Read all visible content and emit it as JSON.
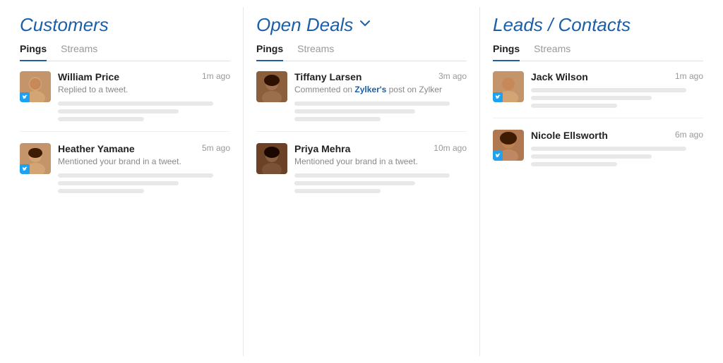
{
  "columns": [
    {
      "title": "Customers",
      "hasDropdown": false,
      "tabs": [
        {
          "label": "Pings",
          "active": true
        },
        {
          "label": "Streams",
          "active": false
        }
      ],
      "items": [
        {
          "id": "william",
          "name": "William Price",
          "time": "1m ago",
          "description": "Replied to a tweet.",
          "avatarClass": "face-william",
          "hasBadge": true,
          "skeletons": [
            {
              "width": "w-full"
            },
            {
              "width": "w-3q"
            },
            {
              "width": "w-half"
            }
          ]
        },
        {
          "id": "heather",
          "name": "Heather Yamane",
          "time": "5m ago",
          "description": "Mentioned your brand in a tweet.",
          "avatarClass": "face-heather",
          "hasBadge": true,
          "skeletons": [
            {
              "width": "w-full"
            },
            {
              "width": "w-3q"
            },
            {
              "width": "w-half"
            }
          ]
        }
      ]
    },
    {
      "title": "Open Deals",
      "hasDropdown": true,
      "tabs": [
        {
          "label": "Pings",
          "active": true
        },
        {
          "label": "Streams",
          "active": false
        }
      ],
      "items": [
        {
          "id": "tiffany",
          "name": "Tiffany Larsen",
          "time": "3m ago",
          "description": "Commented on Zylker's post on Zylker",
          "descriptionBold": "Zylker's",
          "avatarClass": "face-tiffany",
          "hasBadge": false,
          "skeletons": [
            {
              "width": "w-full"
            },
            {
              "width": "w-3q"
            },
            {
              "width": "w-half"
            }
          ]
        },
        {
          "id": "priya",
          "name": "Priya Mehra",
          "time": "10m ago",
          "description": "Mentioned your brand in a tweet.",
          "avatarClass": "face-priya",
          "hasBadge": false,
          "skeletons": [
            {
              "width": "w-full"
            },
            {
              "width": "w-3q"
            },
            {
              "width": "w-half"
            }
          ]
        }
      ]
    },
    {
      "title": "Leads / Contacts",
      "hasDropdown": false,
      "tabs": [
        {
          "label": "Pings",
          "active": true
        },
        {
          "label": "Streams",
          "active": false
        }
      ],
      "items": [
        {
          "id": "jack",
          "name": "Jack Wilson",
          "time": "1m ago",
          "description": "",
          "avatarClass": "face-jack",
          "hasBadge": true,
          "skeletons": [
            {
              "width": "w-full"
            },
            {
              "width": "w-3q"
            },
            {
              "width": "w-half"
            }
          ]
        },
        {
          "id": "nicole",
          "name": "Nicole Ellsworth",
          "time": "6m ago",
          "description": "",
          "avatarClass": "face-nicole",
          "hasBadge": true,
          "skeletons": [
            {
              "width": "w-full"
            },
            {
              "width": "w-3q"
            },
            {
              "width": "w-half"
            }
          ]
        }
      ]
    }
  ],
  "labels": {
    "pings": "Pings",
    "streams": "Streams"
  }
}
